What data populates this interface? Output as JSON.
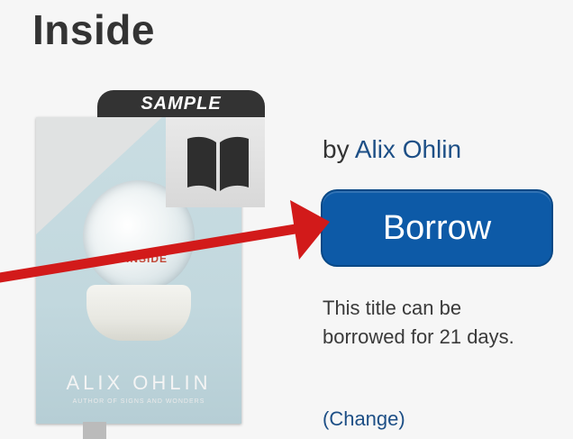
{
  "title": "Inside",
  "cover": {
    "sample_label": "SAMPLE",
    "book_title": "INSIDE",
    "author": "ALIX OHLIN",
    "subtitle": "AUTHOR OF SIGNS AND WONDERS"
  },
  "byline": {
    "prefix": "by",
    "author": "Alix Ohlin"
  },
  "borrow_button": "Borrow",
  "loan_note": "This title can be borrowed for 21 days.",
  "change_link": "(Change)",
  "colors": {
    "button": "#0d5aa7",
    "link": "#1d4f86",
    "arrow": "#d21a1a"
  }
}
